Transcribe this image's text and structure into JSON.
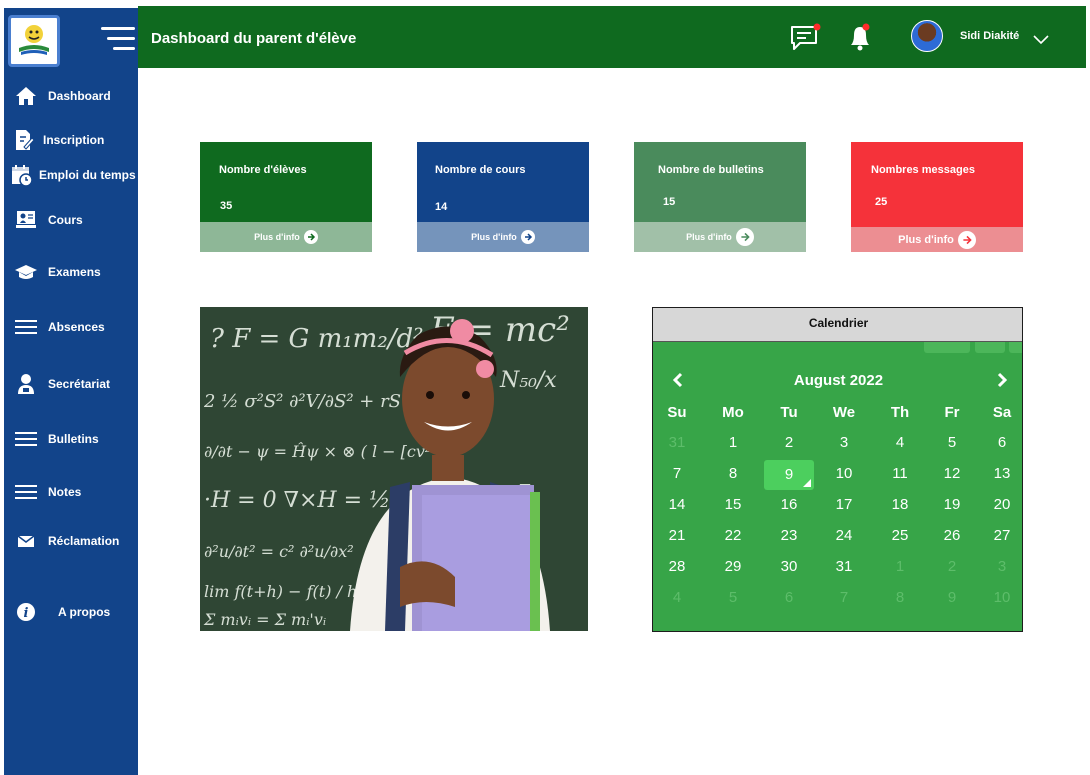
{
  "header": {
    "title": "Dashboard du parent d'élève",
    "user_name": "Sidi Diakité"
  },
  "colors": {
    "sidebar": "#12448a",
    "header": "#0f6a1f",
    "card_1": "#0f6a1f",
    "card_2": "#12448a",
    "card_3": "#4a8b5c",
    "card_4": "#f5323a",
    "calendar": "#37a548",
    "notification_dot": "#ff2b2b"
  },
  "sidebar": {
    "items": [
      {
        "label": "Dashboard",
        "icon": "home-icon"
      },
      {
        "label": "Inscription",
        "icon": "edit-document-icon"
      },
      {
        "label": "Emploi du temps",
        "icon": "calendar-icon"
      },
      {
        "label": "Cours",
        "icon": "board-icon"
      },
      {
        "label": "Examens",
        "icon": "graduation-cap-icon"
      },
      {
        "label": "Absences",
        "icon": "menu-icon"
      },
      {
        "label": "Secrétariat",
        "icon": "user-icon"
      },
      {
        "label": "Bulletins",
        "icon": "menu-icon"
      },
      {
        "label": "Notes",
        "icon": "menu-icon"
      },
      {
        "label": "Réclamation",
        "icon": "mail-icon"
      },
      {
        "label": "A propos",
        "icon": "info-icon"
      }
    ]
  },
  "cards": [
    {
      "title": "Nombre d'élèves",
      "value": "35",
      "more": "Plus d'info"
    },
    {
      "title": "Nombre de cours",
      "value": "14",
      "more": "Plus d'info"
    },
    {
      "title": "Nombre de bulletins",
      "value": "15",
      "more": "Plus d'info"
    },
    {
      "title": "Nombres messages",
      "value": "25",
      "more": "Plus d'info"
    }
  ],
  "calendar": {
    "title": "Calendrier",
    "month": "August 2022",
    "weekdays": [
      "Su",
      "Mo",
      "Tu",
      "We",
      "Th",
      "Fr",
      "Sa"
    ],
    "weeks": [
      [
        "31",
        "1",
        "2",
        "3",
        "4",
        "5",
        "6"
      ],
      [
        "7",
        "8",
        "9",
        "10",
        "11",
        "12",
        "13"
      ],
      [
        "14",
        "15",
        "16",
        "17",
        "18",
        "19",
        "20"
      ],
      [
        "21",
        "22",
        "23",
        "24",
        "25",
        "26",
        "27"
      ],
      [
        "28",
        "29",
        "30",
        "31",
        "1",
        "2",
        "3"
      ],
      [
        "4",
        "5",
        "6",
        "7",
        "8",
        "9",
        "10"
      ]
    ],
    "selected_day": "9"
  }
}
